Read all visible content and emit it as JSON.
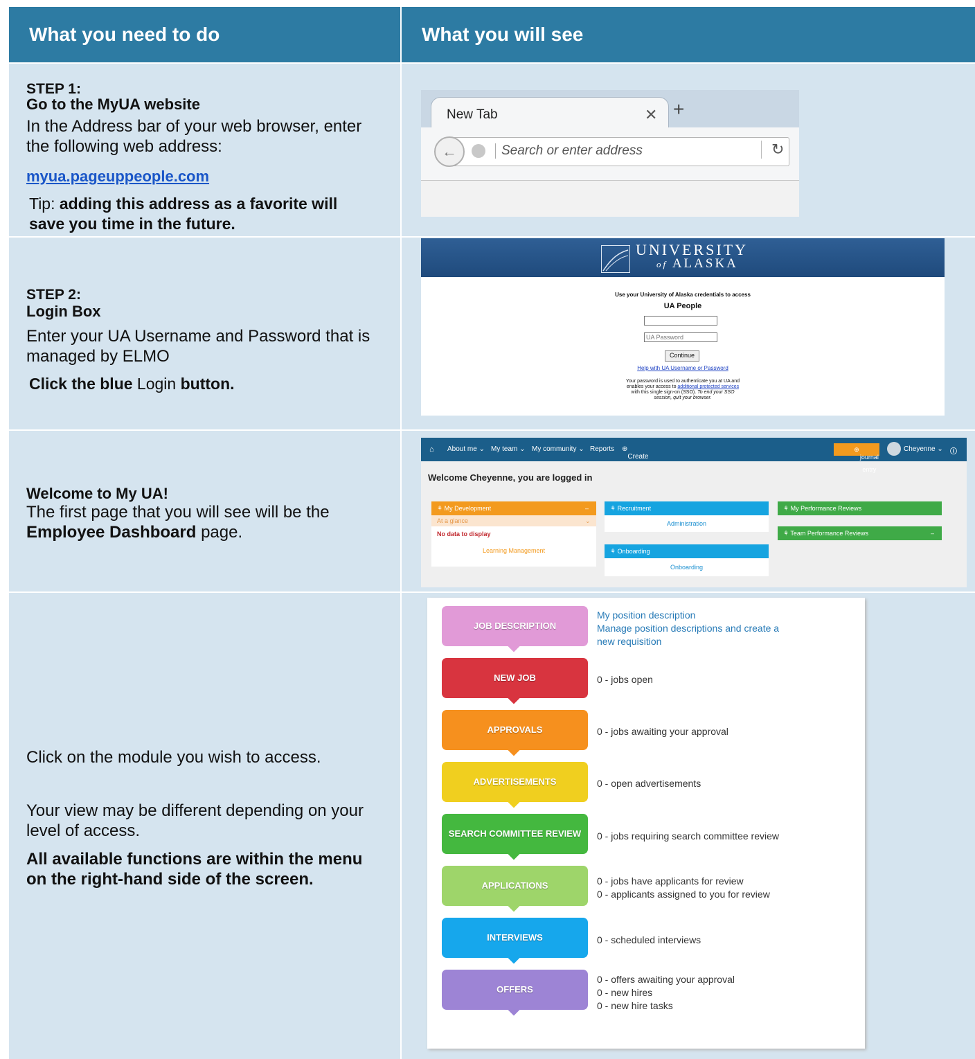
{
  "header": {
    "left": "What you need to do",
    "right": "What you will see"
  },
  "step1": {
    "label": "STEP 1:",
    "title": "Go to the MyUA website",
    "body": "In the Address bar of your web browser, enter the following web address:",
    "link": "myua.pageuppeople.com",
    "tip_prefix": "Tip: ",
    "tip_bold": "adding this address as a favorite will save you time in the future.",
    "browser": {
      "tab_title": "New Tab",
      "address_placeholder": "Search or enter address"
    }
  },
  "step2": {
    "label": "STEP 2:",
    "title": "Login Box",
    "body": "Enter your UA Username and Password that is managed by ELMO",
    "click_1": "Click the blue",
    "click_2": " Login ",
    "click_3": "button.",
    "login": {
      "university": "UNIVERSITY",
      "of": "of",
      "alaska": "ALASKA",
      "intro": "Use your University of Alaska credentials to access",
      "app": "UA People",
      "password_placeholder": "UA Password",
      "continue": "Continue",
      "help": "Help with UA Username or Password",
      "note_1": "Your password is used to authenticate you at UA and",
      "note_2a": "enables your access to ",
      "note_2b": "additional protected services",
      "note_3": "with this single sign-on (SSO). ",
      "note_3b": "To end your SSO",
      "note_4": "session, quit your browser."
    }
  },
  "step3": {
    "title": "Welcome to My UA!",
    "body_1": "The first page that you will see will be the",
    "body_bold": "Employee Dashboard",
    "body_2": " page.",
    "dashboard": {
      "nav": [
        "About me ⌄",
        "My team ⌄",
        "My community ⌄",
        "Reports",
        "Create"
      ],
      "journal": "journal entry",
      "user": "Cheyenne ⌄",
      "welcome": "Welcome Cheyenne, you are logged in",
      "my_dev": "My Development",
      "at_glance": "At a glance",
      "no_data": "No data to display",
      "learning": "Learning Management",
      "recruitment": "Recruitment",
      "administration": "Administration",
      "onboarding": "Onboarding",
      "onboarding_link": "Onboarding",
      "my_perf": "My Performance Reviews",
      "team_perf": "Team Performance Reviews",
      "colors": {
        "orange": "#f39a1e",
        "blue": "#16a4e0",
        "green": "#3faa47"
      }
    }
  },
  "step4": {
    "p1": "Click on the module you wish to access.",
    "p2": "Your view may be different depending on your level of access.",
    "p3": "All available functions are within the menu on the right-hand side of the screen.",
    "modules": [
      {
        "label": "JOB DESCRIPTION",
        "color": "#e19ad7",
        "lines": [
          "My position description",
          "Manage position descriptions and create a",
          "new requisition"
        ]
      },
      {
        "label": "NEW JOB",
        "color": "#d8343f",
        "lines": [
          "0 - jobs open"
        ]
      },
      {
        "label": "APPROVALS",
        "color": "#f6901e",
        "lines": [
          "0 - jobs awaiting your approval"
        ]
      },
      {
        "label": "ADVERTISEMENTS",
        "color": "#f0cf1f",
        "lines": [
          "0 - open advertisements"
        ]
      },
      {
        "label": "SEARCH COMMITTEE REVIEW",
        "color": "#44b83f",
        "lines": [
          "0 - jobs requiring search committee review"
        ]
      },
      {
        "label": "APPLICATIONS",
        "color": "#9ed56a",
        "lines": [
          "0 - jobs have applicants for review",
          "0 - applicants assigned to you for review"
        ]
      },
      {
        "label": "INTERVIEWS",
        "color": "#16a7ec",
        "lines": [
          "0 - scheduled interviews"
        ]
      },
      {
        "label": "OFFERS",
        "color": "#9d84d5",
        "lines": [
          "0 - offers awaiting your approval",
          "0 - new hires",
          "0 - new hire tasks"
        ]
      }
    ]
  }
}
